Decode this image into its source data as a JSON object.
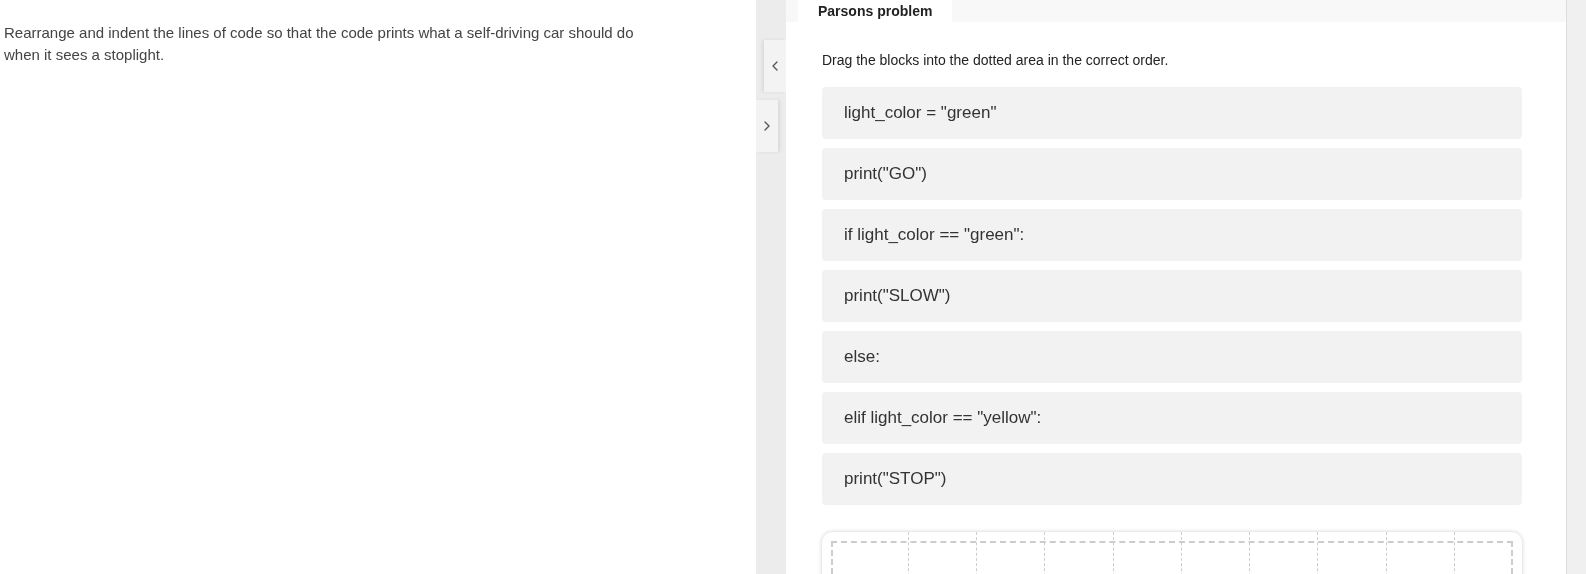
{
  "prompt": "Rearrange and indent the lines of code so that the code prints what a self-driving car should do when it sees a stoplight.",
  "panel_toggles": [
    {
      "kind": "collapse"
    },
    {
      "kind": "expand"
    }
  ],
  "tabs": [
    {
      "label": "Parsons problem",
      "selected": true
    }
  ],
  "instruction": "Drag the blocks into the dotted area in the correct order.",
  "blocks": [
    {
      "code": "light_color = \"green\""
    },
    {
      "code": "print(\"GO\")"
    },
    {
      "code": "if light_color == \"green\":"
    },
    {
      "code": "print(\"SLOW\")"
    },
    {
      "code": "else:"
    },
    {
      "code": "elif light_color == \"yellow\":"
    },
    {
      "code": "print(\"STOP\")"
    }
  ]
}
